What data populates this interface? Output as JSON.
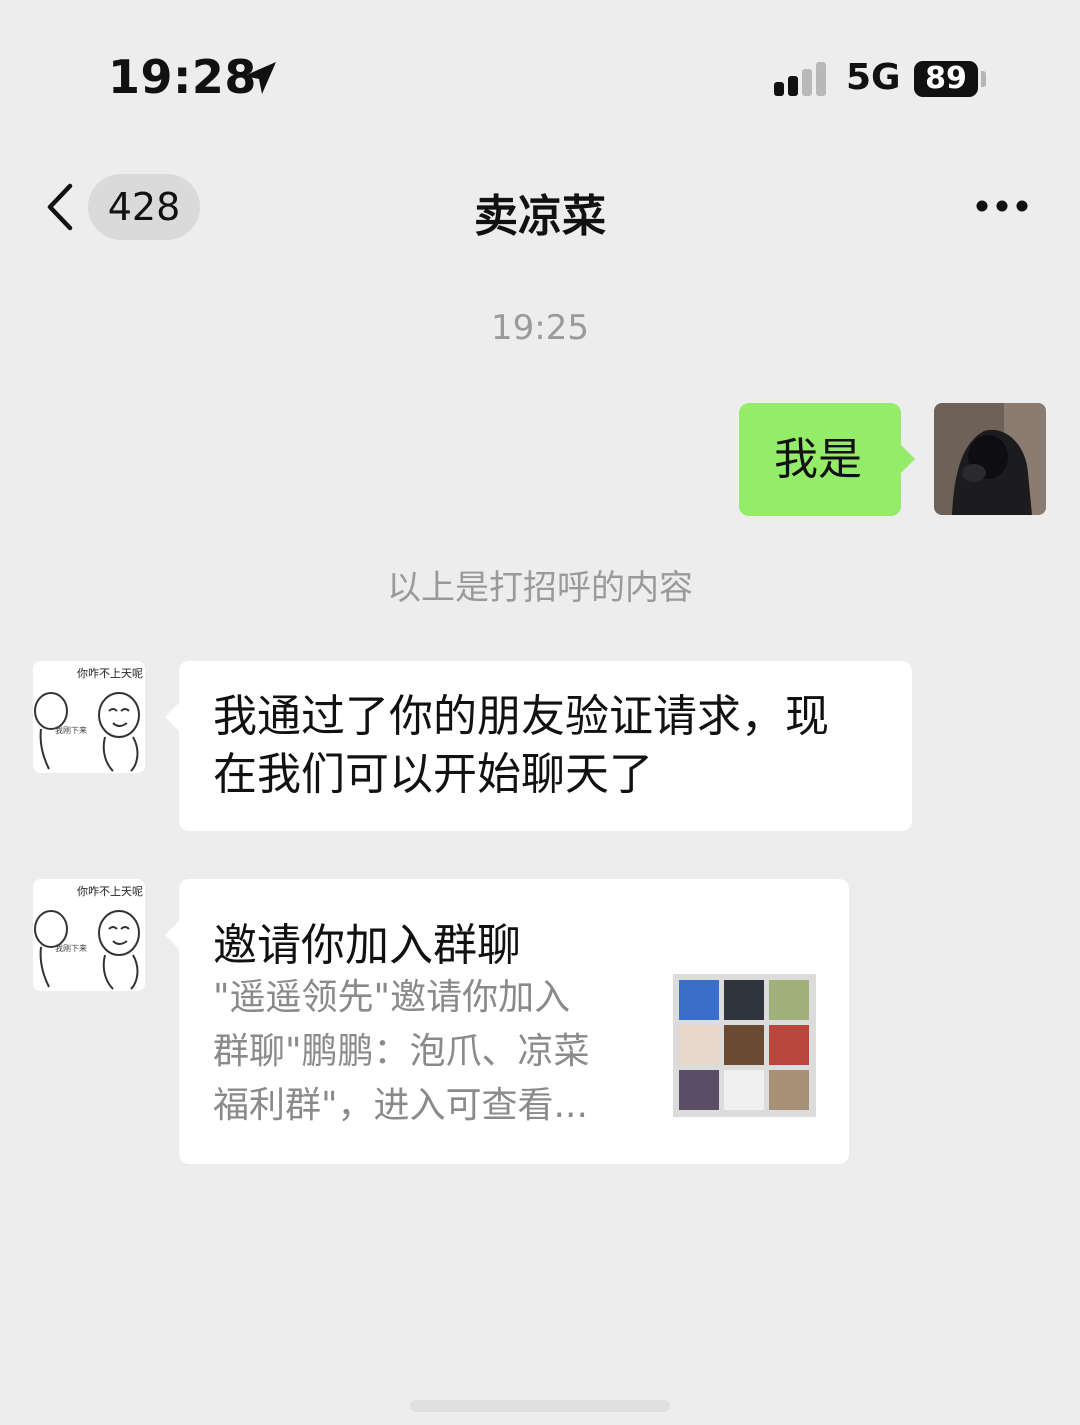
{
  "status_bar": {
    "time": "19:28",
    "network": "5G",
    "battery": "89"
  },
  "nav": {
    "back_count": "428",
    "title": "卖凉菜"
  },
  "chat": {
    "timestamp": "19:25",
    "sent_message": "我是",
    "system_note": "以上是打招呼的内容",
    "received_message_line1": "我通过了你的朋友验证请求，现",
    "received_message_line2": "在我们可以开始聊天了",
    "invite_card": {
      "title": "邀请你加入群聊",
      "desc_line1": "\"遥遥领先\"邀请你加入",
      "desc_line2": "群聊\"鹏鹏：泡爪、凉菜",
      "desc_line3": "福利群\"，进入可查看..."
    },
    "avatar_caption_top": "你咋不上天呢",
    "avatar_caption_mid": "我刚下来"
  },
  "colors": {
    "sent_bubble": "#95ec69",
    "background": "#ededed"
  }
}
